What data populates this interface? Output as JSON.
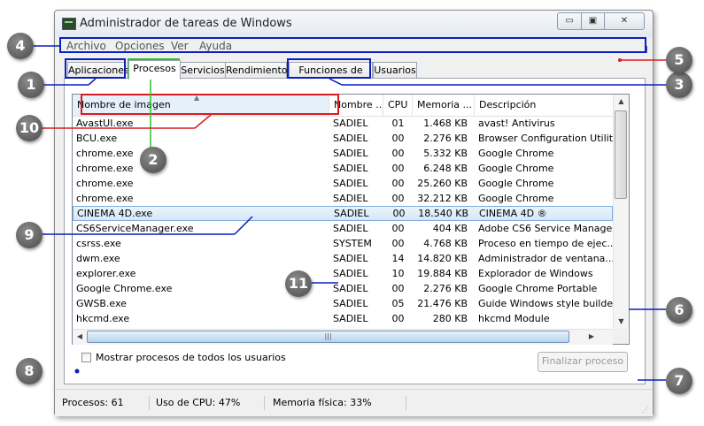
{
  "window": {
    "title": "Administrador de tareas de Windows",
    "controls": {
      "minimize": "▭",
      "maximize": "▣",
      "close": "✕"
    }
  },
  "menu": [
    "Archivo",
    "Opciones",
    "Ver",
    "Ayuda"
  ],
  "tabs": [
    "Aplicaciones",
    "Procesos",
    "Servicios",
    "Rendimiento",
    "Funciones de red",
    "Usuarios"
  ],
  "active_tab": "Procesos",
  "columns": [
    "Nombre de imagen",
    "Nombre ...",
    "CPU",
    "Memoria ...",
    "Descripción"
  ],
  "processes": [
    [
      "AvastUI.exe",
      "SADIEL",
      "01",
      "1.468 KB",
      "avast! Antivirus"
    ],
    [
      "BCU.exe",
      "SADIEL",
      "00",
      "2.276 KB",
      "Browser Configuration Utility"
    ],
    [
      "chrome.exe",
      "SADIEL",
      "00",
      "5.332 KB",
      "Google Chrome"
    ],
    [
      "chrome.exe",
      "SADIEL",
      "00",
      "6.248 KB",
      "Google Chrome"
    ],
    [
      "chrome.exe",
      "SADIEL",
      "00",
      "25.260 KB",
      "Google Chrome"
    ],
    [
      "chrome.exe",
      "SADIEL",
      "00",
      "32.212 KB",
      "Google Chrome"
    ],
    [
      "CINEMA 4D.exe",
      "SADIEL",
      "00",
      "18.540 KB",
      "CINEMA 4D ®"
    ],
    [
      "CS6ServiceManager.exe",
      "SADIEL",
      "00",
      "404 KB",
      "Adobe CS6 Service Manager"
    ],
    [
      "csrss.exe",
      "SYSTEM",
      "00",
      "4.768 KB",
      "Proceso en tiempo de ejec..."
    ],
    [
      "dwm.exe",
      "SADIEL",
      "14",
      "14.820 KB",
      "Administrador de ventana..."
    ],
    [
      "explorer.exe",
      "SADIEL",
      "10",
      "19.884 KB",
      "Explorador de Windows"
    ],
    [
      "Google Chrome.exe",
      "SADIEL",
      "00",
      "2.276 KB",
      "Google Chrome Portable"
    ],
    [
      "GWSB.exe",
      "SADIEL",
      "05",
      "21.476 KB",
      "Guide Windows style builder"
    ],
    [
      "hkcmd.exe",
      "SADIEL",
      "00",
      "280 KB",
      "hkcmd Module"
    ]
  ],
  "selected_row": 6,
  "show_all_users_label": "Mostrar procesos de todos los usuarios",
  "end_process_label": "Finalizar proceso",
  "status": {
    "processes": "Procesos: 61",
    "cpu": "Uso de CPU: 47%",
    "memory": "Memoria física: 33%"
  },
  "callouts": [
    "1",
    "2",
    "3",
    "4",
    "5",
    "6",
    "7",
    "8",
    "9",
    "10",
    "11"
  ],
  "colors": {
    "callout_blue": "#0a1fbf",
    "callout_red": "#d81c24",
    "callout_green": "#2fbf2f"
  }
}
